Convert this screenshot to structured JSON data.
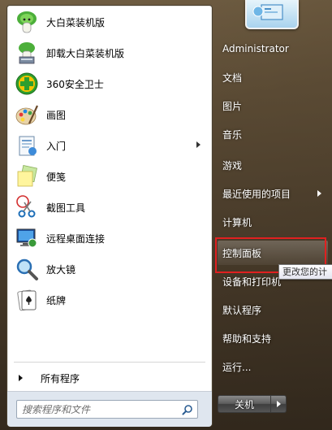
{
  "programs": [
    {
      "label": "大白菜装机版",
      "icon": "dabaicai-icon"
    },
    {
      "label": "卸载大白菜装机版",
      "icon": "uninstall-icon"
    },
    {
      "label": "360安全卫士",
      "icon": "360-shield-icon"
    },
    {
      "label": "画图",
      "icon": "paint-icon"
    },
    {
      "label": "入门",
      "icon": "getting-started-icon",
      "submenu": true
    },
    {
      "label": "便笺",
      "icon": "sticky-notes-icon"
    },
    {
      "label": "截图工具",
      "icon": "snipping-tool-icon"
    },
    {
      "label": "远程桌面连接",
      "icon": "remote-desktop-icon"
    },
    {
      "label": "放大镜",
      "icon": "magnifier-icon"
    },
    {
      "label": "纸牌",
      "icon": "solitaire-icon"
    }
  ],
  "all_programs_label": "所有程序",
  "search": {
    "placeholder": "搜索程序和文件"
  },
  "right_menu": [
    {
      "label": "Administrator"
    },
    {
      "label": "文档"
    },
    {
      "label": "图片"
    },
    {
      "label": "音乐"
    },
    {
      "label": "游戏"
    },
    {
      "label": "最近使用的项目",
      "submenu": true
    },
    {
      "label": "计算机"
    },
    {
      "label": "控制面板",
      "highlighted": true
    },
    {
      "label": "设备和打印机"
    },
    {
      "label": "默认程序"
    },
    {
      "label": "帮助和支持"
    },
    {
      "label": "运行..."
    }
  ],
  "tooltip": "更改您的计",
  "shutdown_label": "关机",
  "colors": {
    "highlight_border": "#e02020",
    "panel_bg": "#ffffff"
  }
}
